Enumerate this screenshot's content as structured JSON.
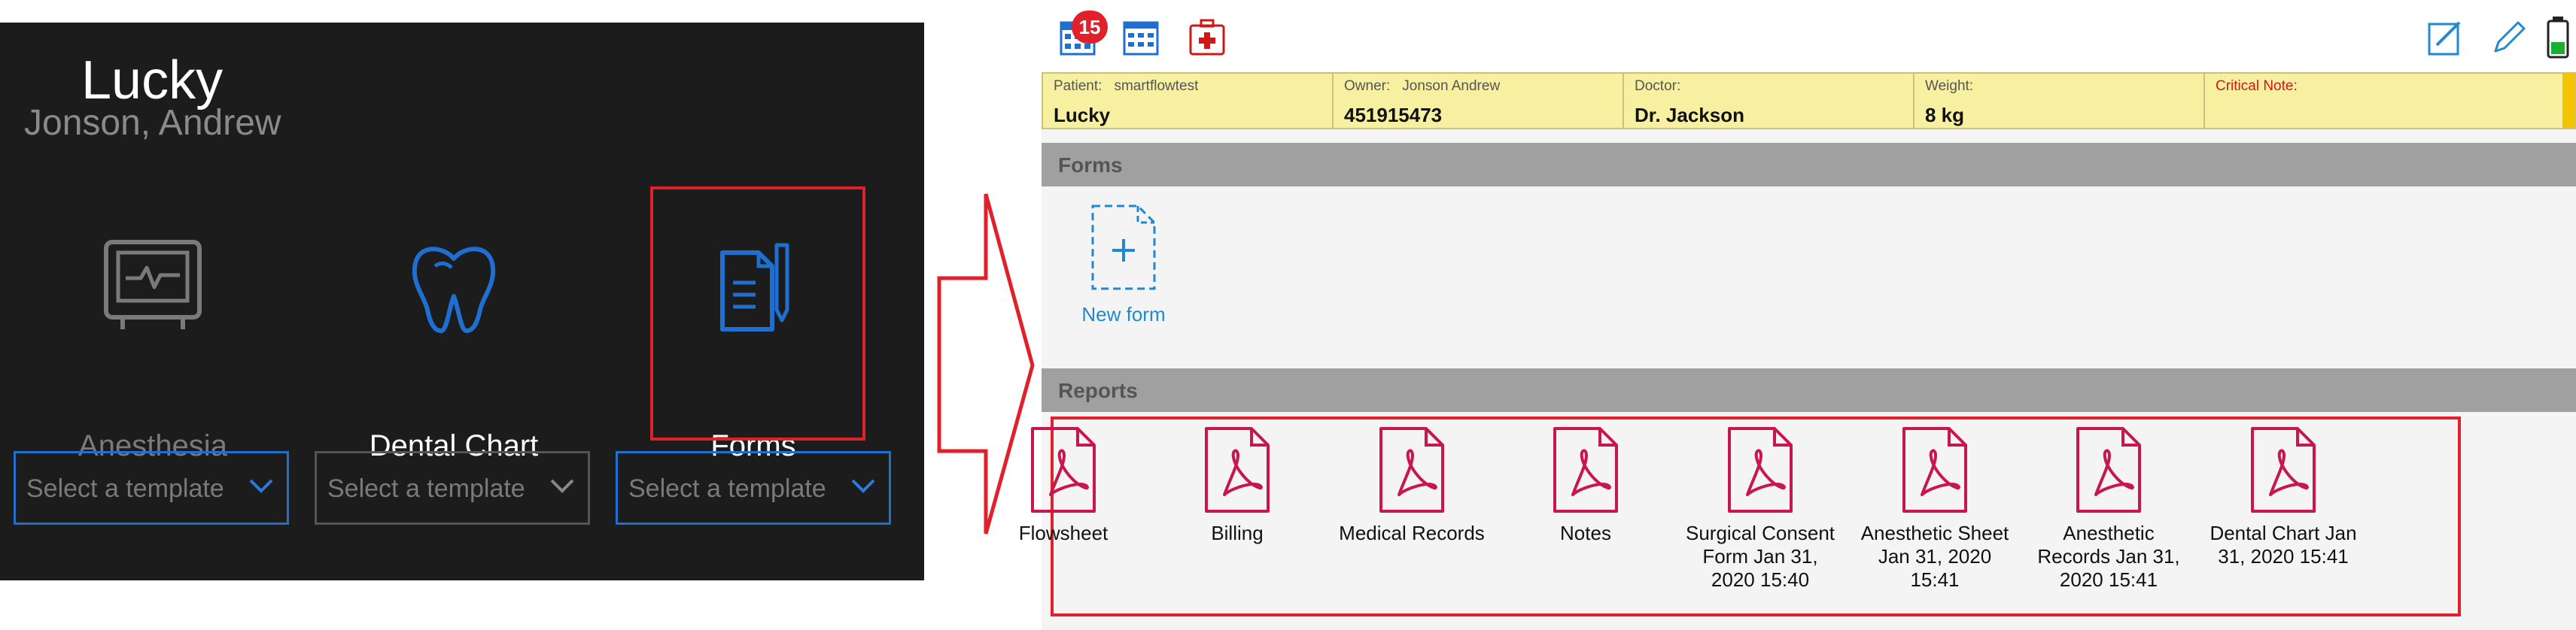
{
  "left": {
    "patient_name": "Lucky",
    "owner_name": "Jonson, Andrew",
    "modules": [
      {
        "label": "Anesthesia"
      },
      {
        "label": "Dental Chart"
      },
      {
        "label": "Forms"
      }
    ],
    "template_placeholder": "Select a template"
  },
  "right": {
    "toolbar": {
      "badge_count": "15",
      "icons": [
        "grid-calendar-icon",
        "table-icon",
        "medical-kit-icon",
        "edit-note-icon",
        "pencil-icon",
        "battery-icon"
      ]
    },
    "patient_bar": {
      "patient_key": "Patient:",
      "patient_sub": "smartflowtest",
      "patient_value": "Lucky",
      "owner_key": "Owner:",
      "owner_sub": "Jonson Andrew",
      "owner_value": "451915473",
      "doctor_key": "Doctor:",
      "doctor_value": "Dr. Jackson",
      "weight_key": "Weight:",
      "weight_value": "8 kg",
      "critical_key": "Critical Note:"
    },
    "forms_section": {
      "title": "Forms",
      "new_form_label": "New form"
    },
    "reports_section": {
      "title": "Reports",
      "items": [
        {
          "line1": "Flowsheet",
          "line2": "",
          "line3": ""
        },
        {
          "line1": "Billing",
          "line2": "",
          "line3": ""
        },
        {
          "line1": "Medical Records",
          "line2": "",
          "line3": ""
        },
        {
          "line1": "Notes",
          "line2": "",
          "line3": ""
        },
        {
          "line1": "Surgical Consent",
          "line2": "Form Jan 31,",
          "line3": "2020 15:40"
        },
        {
          "line1": "Anesthetic Sheet",
          "line2": "Jan 31, 2020",
          "line3": "15:41"
        },
        {
          "line1": "Anesthetic",
          "line2": "Records Jan 31,",
          "line3": "2020 15:41"
        },
        {
          "line1": "Dental Chart Jan",
          "line2": "31, 2020 15:41",
          "line3": ""
        }
      ]
    }
  },
  "colors": {
    "accent_blue": "#1f6fd0",
    "highlight_red": "#e0202a",
    "pdf_red": "#c8164f",
    "patient_bar_yellow": "#f7f0a0"
  }
}
